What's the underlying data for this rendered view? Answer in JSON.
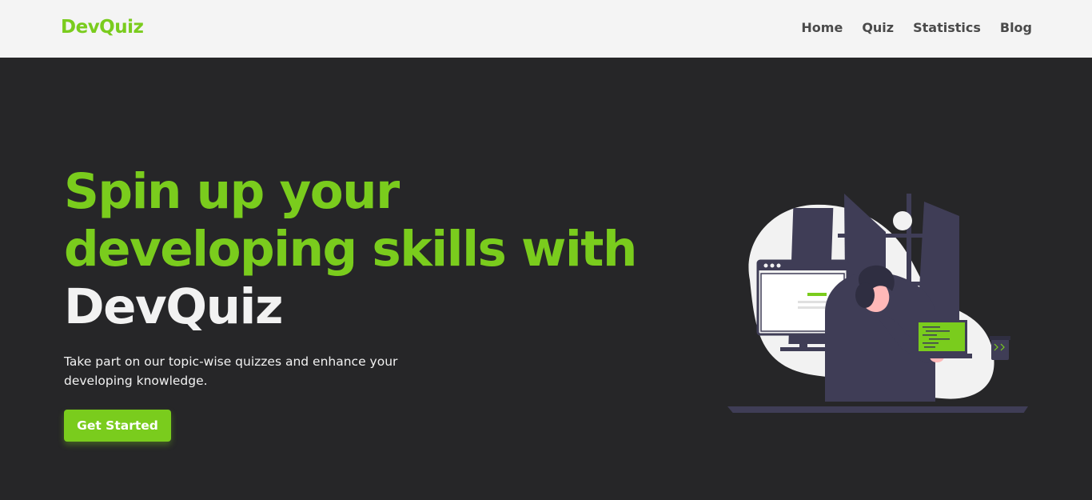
{
  "navbar": {
    "brand": "DevQuiz",
    "links": [
      {
        "label": "Home"
      },
      {
        "label": "Quiz"
      },
      {
        "label": "Statistics"
      },
      {
        "label": "Blog"
      }
    ]
  },
  "hero": {
    "headline_part1": "Spin up your developing skills with ",
    "headline_part2": "DevQuiz",
    "lead": "Take part on our topic-wise quizzes and enhance your developing knowledge.",
    "cta_label": "Get Started",
    "illustration_icon": "developer-at-desk-illustration"
  },
  "colors": {
    "accent": "#7acc1d",
    "navbar_bg": "#f4f4f4",
    "hero_bg": "#262628",
    "nav_text": "#4a4a4a",
    "hero_text": "#f2f2f2"
  }
}
